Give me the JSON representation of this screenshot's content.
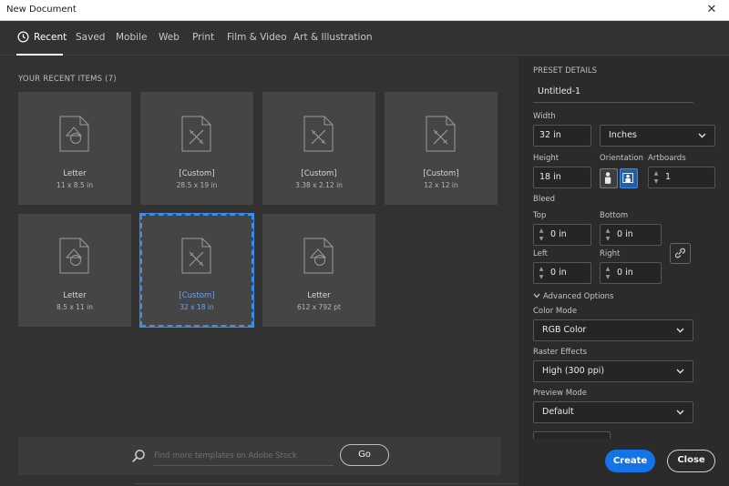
{
  "window": {
    "title": "New Document",
    "close_glyph": "✕"
  },
  "tabs": [
    {
      "label": "Recent",
      "active": true,
      "icon": "clock-icon"
    },
    {
      "label": "Saved"
    },
    {
      "label": "Mobile"
    },
    {
      "label": "Web"
    },
    {
      "label": "Print"
    },
    {
      "label": "Film & Video"
    },
    {
      "label": "Art & Illustration"
    }
  ],
  "recent": {
    "heading": "YOUR RECENT ITEMS  (7)",
    "items": [
      {
        "name": "Letter",
        "size": "11 x 8.5 in",
        "icon": "art-document-icon"
      },
      {
        "name": "[Custom]",
        "size": "28.5 x 19 in",
        "icon": "custom-document-icon"
      },
      {
        "name": "[Custom]",
        "size": "3.38 x 2.12 in",
        "icon": "custom-document-icon"
      },
      {
        "name": "[Custom]",
        "size": "12 x 12 in",
        "icon": "custom-document-icon"
      },
      {
        "name": "Letter",
        "size": "8.5 x 11 in",
        "icon": "art-document-icon"
      },
      {
        "name": "[Custom]",
        "size": "32 x 18 in",
        "icon": "custom-document-icon",
        "selected": true
      },
      {
        "name": "Letter",
        "size": "612 x 792 pt",
        "icon": "art-document-icon"
      }
    ]
  },
  "search": {
    "placeholder": "Find more templates on Adobe Stock",
    "go_label": "Go"
  },
  "preset": {
    "heading": "PRESET DETAILS",
    "name": "Untitled-1",
    "width_label": "Width",
    "width_value": "32 in",
    "units_value": "Inches",
    "height_label": "Height",
    "height_value": "18 in",
    "orientation_label": "Orientation",
    "artboards_label": "Artboards",
    "artboards_value": "1",
    "bleed_label": "Bleed",
    "top_label": "Top",
    "top_value": "0 in",
    "bottom_label": "Bottom",
    "bottom_value": "0 in",
    "left_label": "Left",
    "left_value": "0 in",
    "right_label": "Right",
    "right_value": "0 in",
    "advanced_label": "Advanced Options",
    "color_mode_label": "Color Mode",
    "color_mode_value": "RGB Color",
    "raster_label": "Raster Effects",
    "raster_value": "High (300 ppi)",
    "preview_label": "Preview Mode",
    "preview_value": "Default"
  },
  "actions": {
    "create_label": "Create",
    "close_label": "Close"
  },
  "colors": {
    "accent": "#1473e6",
    "selected_border": "#3b8ee6",
    "panel_bg": "#2b2b2b",
    "bg": "#323232",
    "card_bg": "#454545"
  }
}
